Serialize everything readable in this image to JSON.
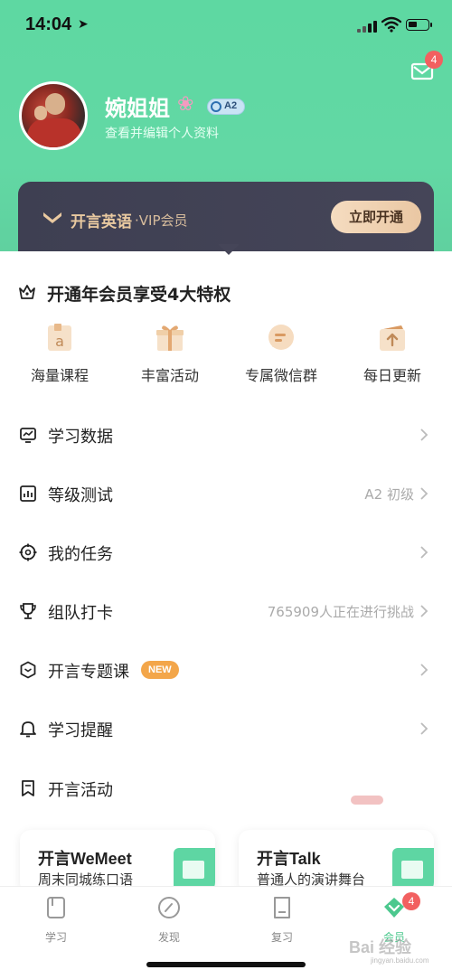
{
  "status_bar": {
    "time": "14:04"
  },
  "header": {
    "mail_badge": "4",
    "username": "婉姐姐",
    "level_badge": "A2",
    "subtitle": "查看并编辑个人资料"
  },
  "vip_banner": {
    "brand": "开言英语",
    "subtitle": "·VIP会员",
    "button": "立即开通"
  },
  "benefits": {
    "title": "开通年会员享受4大特权",
    "items": [
      {
        "label": "海量课程",
        "icon": "course-icon"
      },
      {
        "label": "丰富活动",
        "icon": "gift-icon"
      },
      {
        "label": "专属微信群",
        "icon": "chat-icon"
      },
      {
        "label": "每日更新",
        "icon": "update-icon"
      }
    ]
  },
  "menu": [
    {
      "label": "学习数据",
      "value": "",
      "icon": "chart-icon"
    },
    {
      "label": "等级测试",
      "value": "A2 初级",
      "icon": "bar-chart-icon"
    },
    {
      "label": "我的任务",
      "value": "",
      "icon": "target-icon"
    },
    {
      "label": "组队打卡",
      "value": "765909人正在进行挑战",
      "icon": "trophy-icon"
    },
    {
      "label": "开言专题课",
      "value": "",
      "badge": "NEW",
      "icon": "hexagon-icon"
    },
    {
      "label": "学习提醒",
      "value": "",
      "icon": "bell-icon"
    },
    {
      "label": "开言活动",
      "value": "",
      "icon": "bookmark-icon"
    }
  ],
  "events": [
    {
      "title": "开言WeMeet",
      "subtitle": "周末同城练口语"
    },
    {
      "title": "开言Talk",
      "subtitle": "普通人的演讲舞台"
    }
  ],
  "tabbar": {
    "tabs": [
      {
        "label": "学习",
        "icon": "book-icon"
      },
      {
        "label": "发现",
        "icon": "compass-icon"
      },
      {
        "label": "复习",
        "icon": "review-icon"
      },
      {
        "label": "会员",
        "icon": "vip-diamond-icon",
        "active": true
      }
    ],
    "badge": "4"
  },
  "watermark": {
    "text": "Bai 经验",
    "sub": "jingyan.baidu.com"
  },
  "colors": {
    "primary_green": "#5ed8a2",
    "vip_dark": "#3e3f52",
    "gold": "#e9c9a0",
    "badge_red": "#f26060",
    "new_orange": "#f3a64a"
  }
}
